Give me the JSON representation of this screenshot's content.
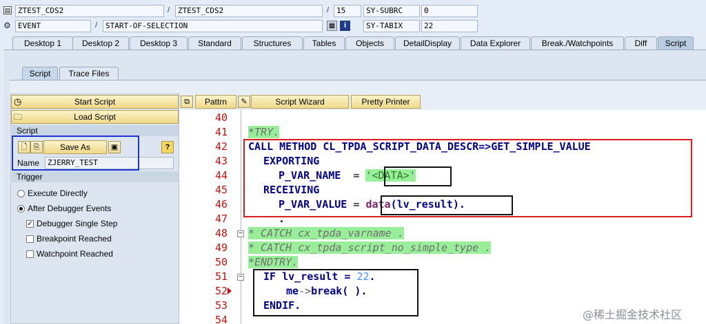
{
  "header": {
    "row1": {
      "field1": "ZTEST_CDS2",
      "field2": "ZTEST_CDS2",
      "line": "15",
      "var_name": "SY-SUBRC",
      "var_value": "0"
    },
    "row2": {
      "field1": "EVENT",
      "field2": "START-OF-SELECTION",
      "var_name": "SY-TABIX",
      "var_value": "22"
    },
    "separator": "/"
  },
  "tabs": [
    "Desktop 1",
    "Desktop 2",
    "Desktop 3",
    "Standard",
    "Structures",
    "Tables",
    "Objects",
    "DetailDisplay",
    "Data Explorer",
    "Break./Watchpoints",
    "Diff",
    "Script"
  ],
  "subtabs": [
    "Script",
    "Trace Files"
  ],
  "left": {
    "start_script": "Start Script",
    "load_script": "Load Script",
    "script_section": "Script",
    "save_as": "Save As",
    "name_label": "Name",
    "name_value": "ZJERRY_TEST",
    "trigger_section": "Trigger",
    "execute_directly": "Execute Directly",
    "after_debugger_events": "After Debugger Events",
    "debugger_single_step": "Debugger Single Step",
    "breakpoint_reached": "Breakpoint Reached",
    "watchpoint_reached": "Watchpoint Reached"
  },
  "editor_toolbar": {
    "pattern": "Pattrn",
    "script_wizard": "Script Wizard",
    "pretty_printer": "Pretty Printer"
  },
  "code": {
    "line_numbers": [
      "40",
      "41",
      "42",
      "43",
      "44",
      "45",
      "46",
      "47",
      "48",
      "49",
      "50",
      "51",
      "52",
      "53",
      "54"
    ],
    "l41": "*TRY.",
    "l42_kw": "CALL METHOD",
    "l42_rest": " CL_TPDA_SCRIPT_DATA_DESCR=>GET_SIMPLE_VALUE",
    "l43": "EXPORTING",
    "l44_name": "P_VAR_NAME",
    "l44_eq": "  = ",
    "l44_val": "'<DATA>'",
    "l45": "RECEIVING",
    "l46_name": "P_VAR_VALUE",
    "l46_eq": " = ",
    "l46_data": "data",
    "l46_arg": "(lv_result).",
    "l47": ".",
    "l48": "* CATCH cx_tpda_varname .",
    "l49": "* CATCH cx_tpda_script_no_simple_type .",
    "l50": "*ENDTRY.",
    "l51_kw": "IF",
    "l51_rest": " lv_result = ",
    "l51_num": "22",
    "l51_end": ".",
    "l52_me": "me",
    "l52_arrow": "->",
    "l52_break": "break",
    "l52_end": "( ).",
    "l53": "ENDIF."
  },
  "watermark": "@稀土掘金技术社区",
  "colors": {
    "highlight": "#99ee99",
    "annotation_red": "#e01b1b",
    "annotation_blue": "#1a35d6"
  }
}
